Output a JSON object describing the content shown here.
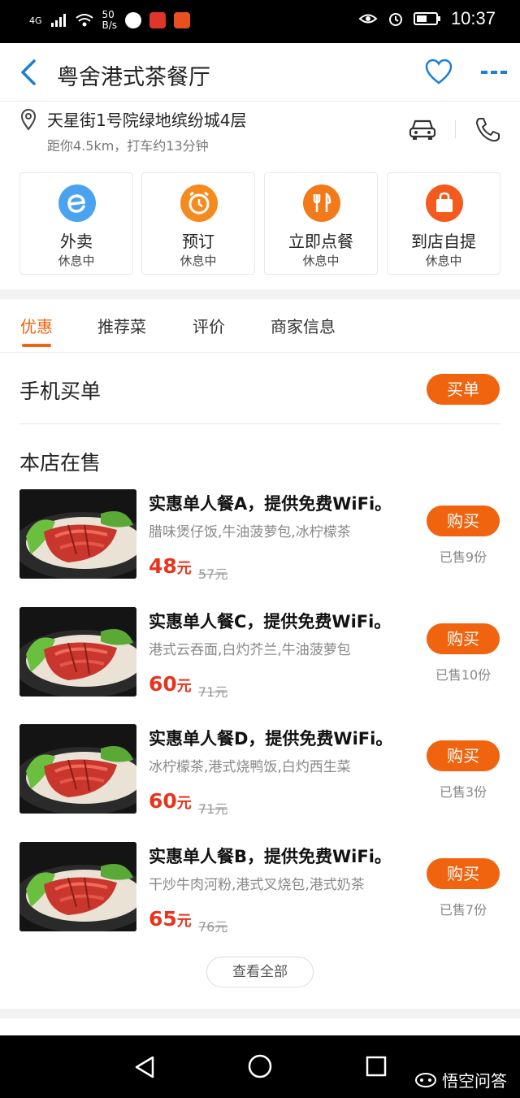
{
  "status_bar": {
    "network": "4G",
    "speed_value": "50",
    "speed_unit": "B/s",
    "time": "10:37"
  },
  "header": {
    "title": "粤舍港式茶餐厅"
  },
  "address": {
    "main": "天星街1号院绿地缤纷城4层",
    "sub": "距你4.5km，打车约13分钟"
  },
  "services": [
    {
      "name": "外卖",
      "state": "休息中",
      "color": "#4aa3f0",
      "icon": "delivery-icon"
    },
    {
      "name": "预订",
      "state": "休息中",
      "color": "#f58a1f",
      "icon": "alarm-clock-icon"
    },
    {
      "name": "立即点餐",
      "state": "休息中",
      "color": "#f27a1a",
      "icon": "fork-knife-icon"
    },
    {
      "name": "到店自提",
      "state": "休息中",
      "color": "#f25a1e",
      "icon": "shopping-bag-icon"
    }
  ],
  "tabs": [
    {
      "label": "优惠",
      "active": true
    },
    {
      "label": "推荐菜",
      "active": false
    },
    {
      "label": "评价",
      "active": false
    },
    {
      "label": "商家信息",
      "active": false
    }
  ],
  "mobile_pay": {
    "label": "手机买单",
    "button": "买单"
  },
  "on_sale": {
    "title": "本店在售",
    "deals": [
      {
        "title": "实惠单人餐A，提供免费WiFi。",
        "desc": "腊味煲仔饭,牛油菠萝包,冰柠檬茶",
        "price": "48",
        "unit": "元",
        "original": "57元",
        "buy": "购买",
        "sold": "已售9份"
      },
      {
        "title": "实惠单人餐C，提供免费WiFi。",
        "desc": "港式云吞面,白灼芥兰,牛油菠萝包",
        "price": "60",
        "unit": "元",
        "original": "71元",
        "buy": "购买",
        "sold": "已售10份"
      },
      {
        "title": "实惠单人餐D，提供免费WiFi。",
        "desc": "冰柠檬茶,港式烧鸭饭,白灼西生菜",
        "price": "60",
        "unit": "元",
        "original": "71元",
        "buy": "购买",
        "sold": "已售3份"
      },
      {
        "title": "实惠单人餐B，提供免费WiFi。",
        "desc": "干炒牛肉河粉,港式叉烧包,港式奶茶",
        "price": "65",
        "unit": "元",
        "original": "76元",
        "buy": "购买",
        "sold": "已售7份"
      }
    ],
    "see_all": "查看全部"
  },
  "watermark": "悟空问答",
  "colors": {
    "accent": "#f0630f",
    "price": "#e8341c",
    "link_blue": "#1a7fd6"
  }
}
